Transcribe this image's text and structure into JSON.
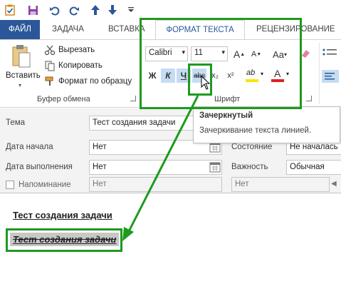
{
  "qat": {
    "icons": [
      "task-icon",
      "save-icon",
      "undo-icon",
      "redo-icon",
      "up-icon",
      "down-icon",
      "customize-icon"
    ]
  },
  "tabs": {
    "file": "ФАЙЛ",
    "task": "ЗАДАЧА",
    "insert": "ВСТАВКА",
    "format_text": "ФОРМАТ ТЕКСТА",
    "review": "РЕЦЕНЗИРОВАНИЕ"
  },
  "clipboard": {
    "paste": "Вставить",
    "cut": "Вырезать",
    "copy": "Копировать",
    "format_painter": "Формат по образцу",
    "group_label": "Буфер обмена"
  },
  "font": {
    "name": "Calibri",
    "size": "11",
    "bold": "Ж",
    "italic": "К",
    "underline": "Ч",
    "strike": "abc",
    "subscript": "x₂",
    "superscript": "x²",
    "grow": "A",
    "shrink": "A",
    "case": "Aa",
    "highlight": "ab",
    "color": "A",
    "group_label": "Шрифт"
  },
  "tooltip": {
    "title": "Зачеркнутый",
    "desc": "Зачеркивание текста линией."
  },
  "form": {
    "subject_label": "Тема",
    "subject_value": "Тест создания задачи",
    "start_label": "Дата начала",
    "start_value": "Нет",
    "due_label": "Дата выполнения",
    "due_value": "Нет",
    "status_label": "Состояние",
    "status_value": "Не началась",
    "priority_label": "Важность",
    "priority_value": "Обычная",
    "reminder_label": "Напоминание",
    "reminder_date": "Нет",
    "reminder_time": "Нет"
  },
  "body": {
    "line1": "Тест создания задачи",
    "line2": "Тест создания задачи"
  },
  "colors": {
    "accent": "#2b579a",
    "highlight_green": "#1e9a1e",
    "font_color_red": "#e02020",
    "highlight_yellow": "#ffe400"
  }
}
